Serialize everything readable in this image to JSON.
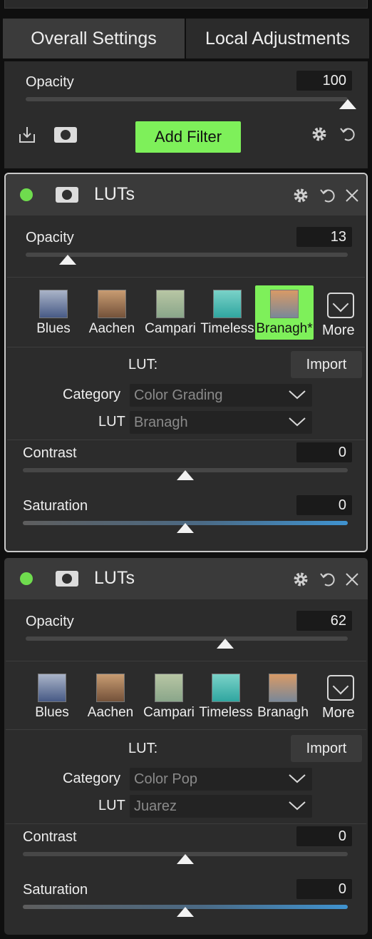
{
  "tabs": {
    "overall": "Overall Settings",
    "local": "Local Adjustments"
  },
  "global": {
    "opacity_label": "Opacity",
    "opacity_value": "100",
    "opacity_level": 1.0,
    "add_filter_label": "Add Filter",
    "icons": [
      "import-icon",
      "mask-icon",
      "gear-icon",
      "reset-icon"
    ]
  },
  "filters": [
    {
      "enabled": true,
      "title": "LUTs",
      "opacity_label": "Opacity",
      "opacity_value": "13",
      "opacity_level": 0.13,
      "presets": [
        {
          "label": "Blues",
          "colors": [
            "#aab4c8",
            "#475a86"
          ],
          "selected": false
        },
        {
          "label": "Aachen",
          "colors": [
            "#c89c72",
            "#74523a"
          ],
          "selected": false
        },
        {
          "label": "Campari",
          "colors": [
            "#b8c6a4",
            "#8aa68a"
          ],
          "selected": false
        },
        {
          "label": "Timeless",
          "colors": [
            "#7ad2c8",
            "#30a6a0"
          ],
          "selected": false
        },
        {
          "label": "Branagh*",
          "colors": [
            "#d89a66",
            "#7a8898"
          ],
          "selected": true
        }
      ],
      "more_label": "More",
      "lut_heading": "LUT:",
      "import_label": "Import",
      "category_label": "Category",
      "category_value": "Color Grading",
      "lut_label": "LUT",
      "lut_value": "Branagh",
      "contrast_label": "Contrast",
      "contrast_value": "0",
      "contrast_level": 0.5,
      "saturation_label": "Saturation",
      "saturation_value": "0",
      "saturation_level": 0.5
    },
    {
      "enabled": true,
      "title": "LUTs",
      "opacity_label": "Opacity",
      "opacity_value": "62",
      "opacity_level": 0.62,
      "presets": [
        {
          "label": "Blues",
          "colors": [
            "#aab4c8",
            "#475a86"
          ],
          "selected": false
        },
        {
          "label": "Aachen",
          "colors": [
            "#c89c72",
            "#74523a"
          ],
          "selected": false
        },
        {
          "label": "Campari",
          "colors": [
            "#b8c6a4",
            "#8aa68a"
          ],
          "selected": false
        },
        {
          "label": "Timeless",
          "colors": [
            "#7ad2c8",
            "#30a6a0"
          ],
          "selected": false
        },
        {
          "label": "Branagh",
          "colors": [
            "#d89a66",
            "#7a8898"
          ],
          "selected": false
        }
      ],
      "more_label": "More",
      "lut_heading": "LUT:",
      "import_label": "Import",
      "category_label": "Category",
      "category_value": "Color Pop",
      "lut_label": "LUT",
      "lut_value": "Juarez",
      "contrast_label": "Contrast",
      "contrast_value": "0",
      "contrast_level": 0.5,
      "saturation_label": "Saturation",
      "saturation_value": "0",
      "saturation_level": 0.5
    }
  ],
  "colors": {
    "accent_green": "#7ef05a",
    "enabled_dot": "#6fdc4e",
    "panel_bg": "#2c2c2c"
  }
}
